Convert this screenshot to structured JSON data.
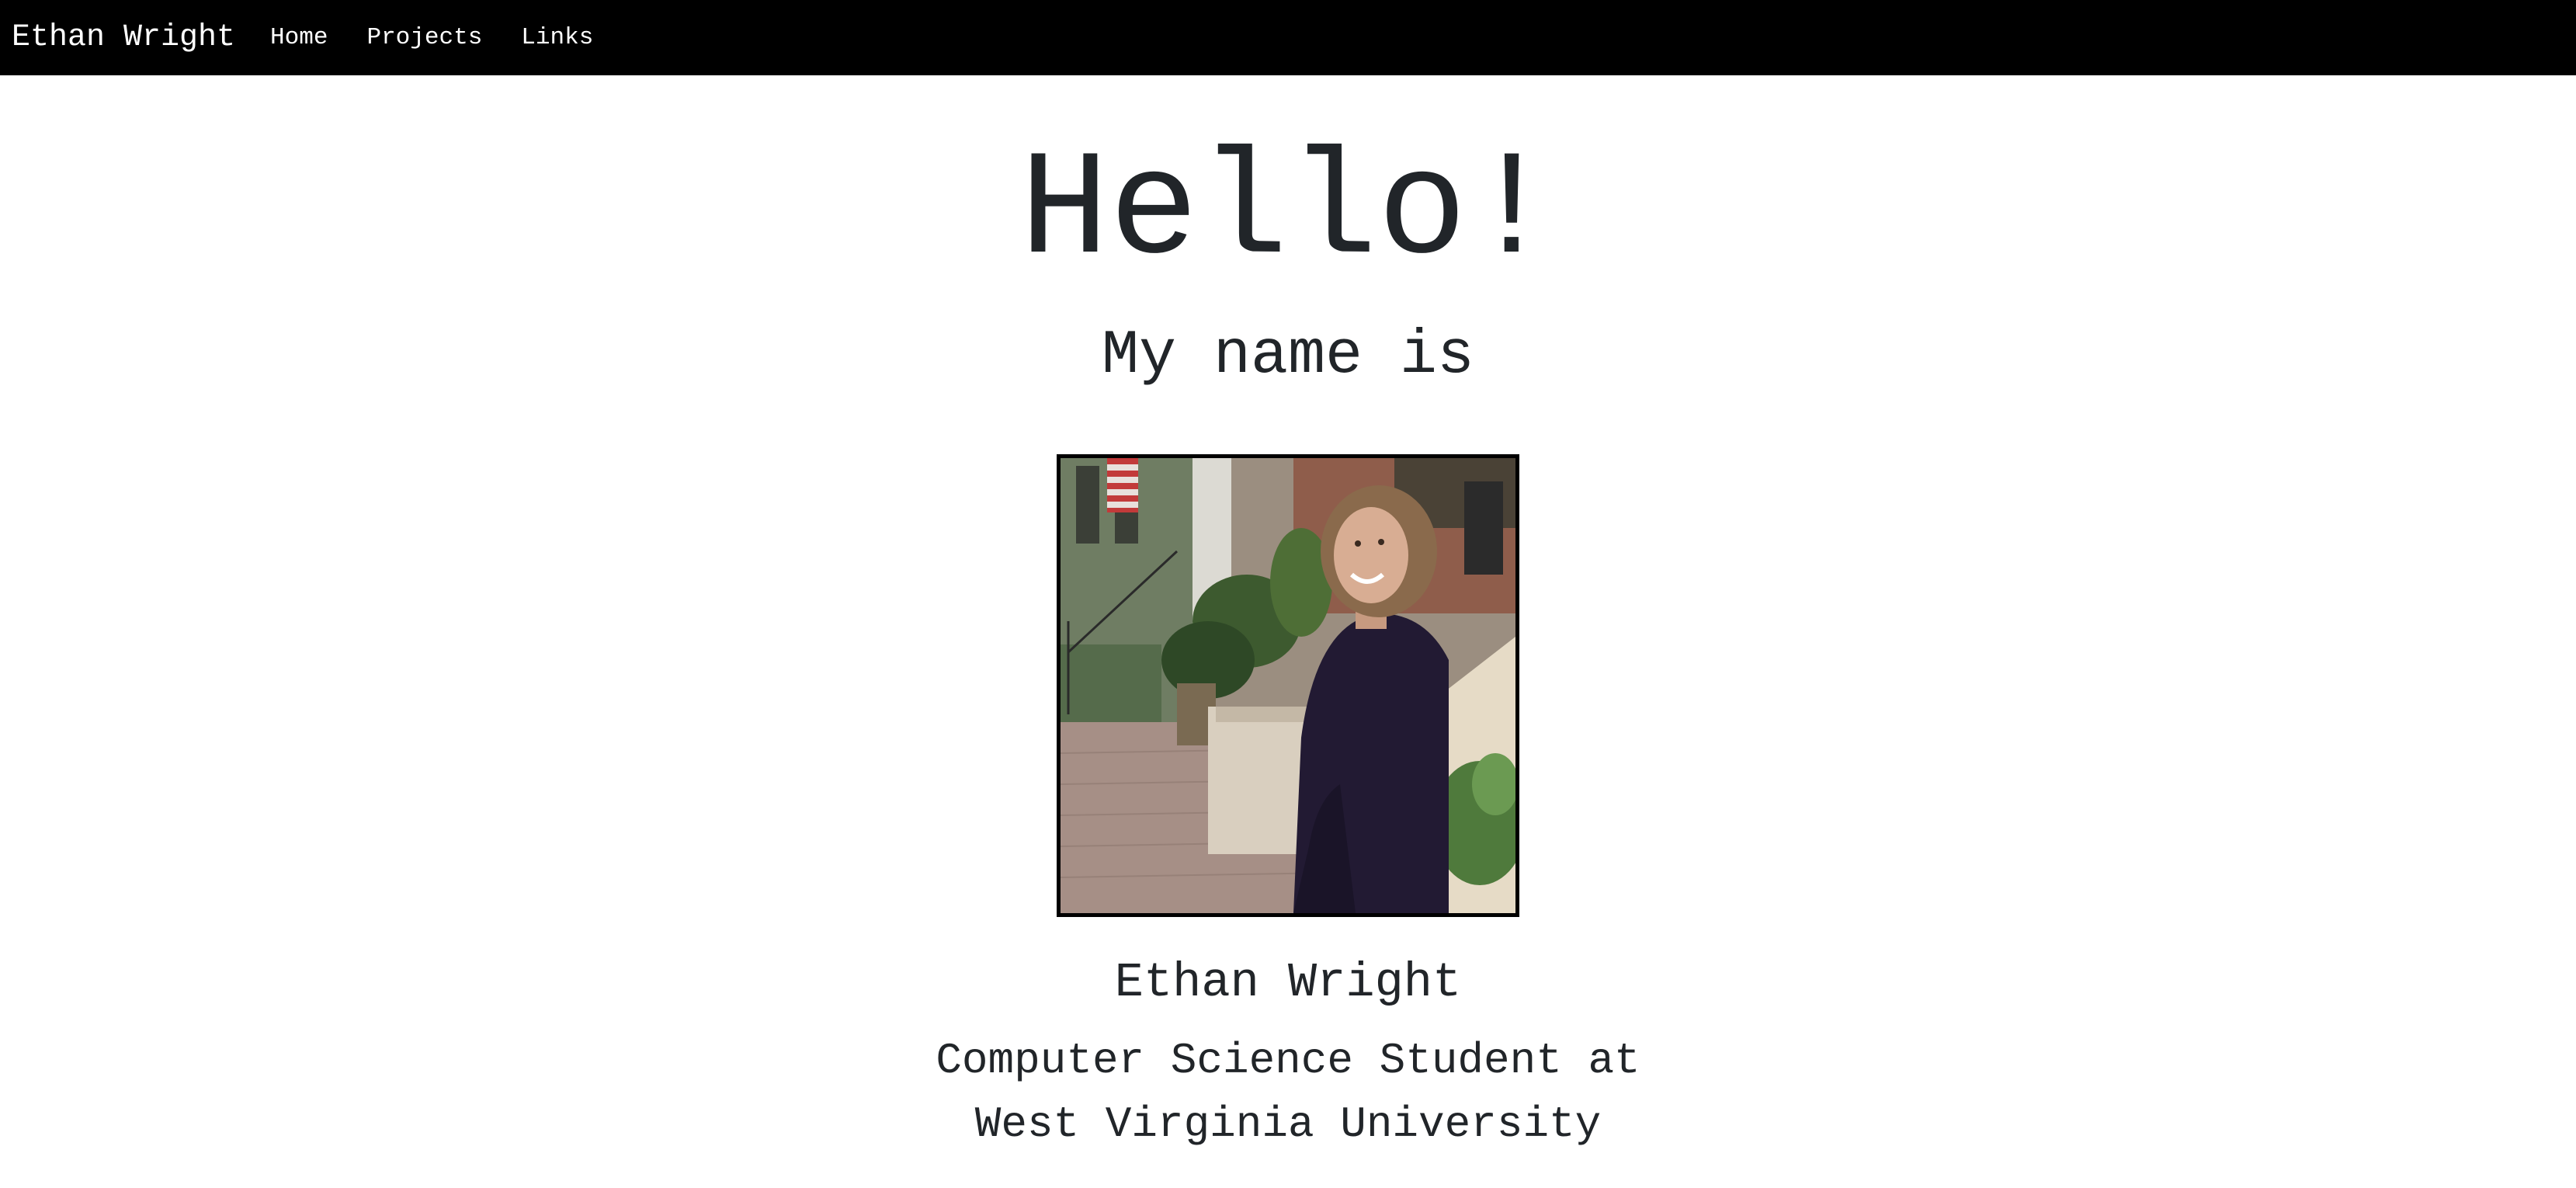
{
  "navbar": {
    "brand": "Ethan Wright",
    "links": [
      {
        "label": "Home"
      },
      {
        "label": "Projects"
      },
      {
        "label": "Links"
      }
    ]
  },
  "hero": {
    "greeting": "Hello!",
    "intro": "My name is"
  },
  "profile": {
    "name": "Ethan Wright",
    "subtitle_line1": "Computer Science Student at",
    "subtitle_line2": "West Virginia University"
  },
  "colors": {
    "navbar_bg": "#000000",
    "nav_text": "#ffffff",
    "body_text": "#212529",
    "photo_border": "#000000"
  }
}
